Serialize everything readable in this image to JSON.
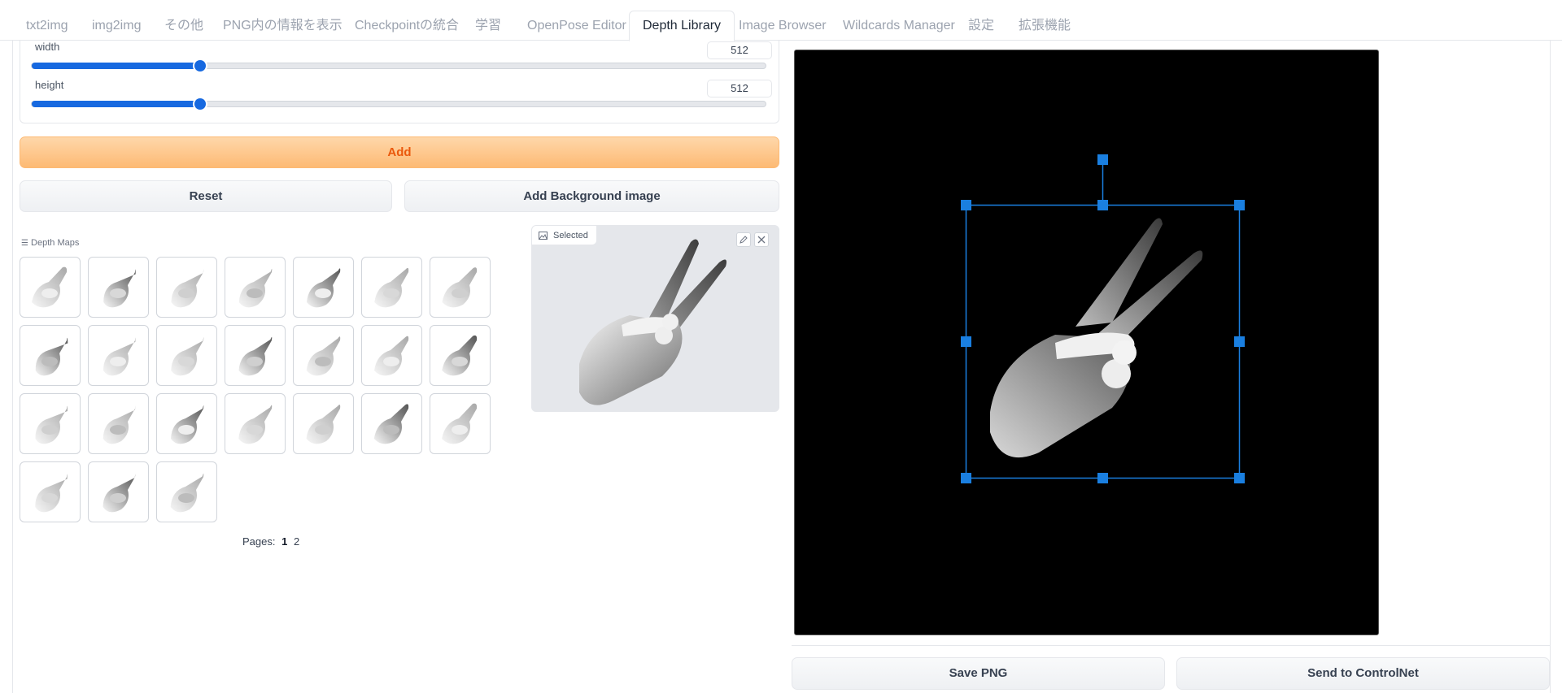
{
  "tabs": [
    {
      "label": "txt2img",
      "active": false
    },
    {
      "label": "img2img",
      "active": false
    },
    {
      "label": "その他",
      "active": false
    },
    {
      "label": "PNG内の情報を表示",
      "active": false
    },
    {
      "label": "Checkpointの統合",
      "active": false
    },
    {
      "label": "学習",
      "active": false
    },
    {
      "label": "OpenPose Editor",
      "active": false
    },
    {
      "label": "Depth Library",
      "active": true
    },
    {
      "label": "Image Browser",
      "active": false
    },
    {
      "label": "Wildcards Manager",
      "active": false
    },
    {
      "label": "設定",
      "active": false
    },
    {
      "label": "拡張機能",
      "active": false
    }
  ],
  "sliders": {
    "width": {
      "label": "width",
      "value": "512",
      "fraction": 0.23
    },
    "height": {
      "label": "height",
      "value": "512",
      "fraction": 0.23
    }
  },
  "buttons": {
    "add": "Add",
    "reset": "Reset",
    "add_background": "Add Background image",
    "save_png": "Save PNG",
    "send_to_controlnet": "Send to ControlNet"
  },
  "gallery": {
    "label": "Depth Maps",
    "thumbnail_count": 24,
    "pages_label": "Pages:",
    "pages": [
      "1",
      "2"
    ],
    "current_page": "1"
  },
  "preview": {
    "label": "Selected"
  },
  "colors": {
    "accent": "#1769e0",
    "primary_button": "#fdba74",
    "primary_button_text": "#ea580c",
    "handle": "#1a7fe0"
  },
  "icons": {
    "gallery": "list-icon",
    "preview": "image-icon",
    "edit": "pencil-icon",
    "close": "close-icon"
  }
}
